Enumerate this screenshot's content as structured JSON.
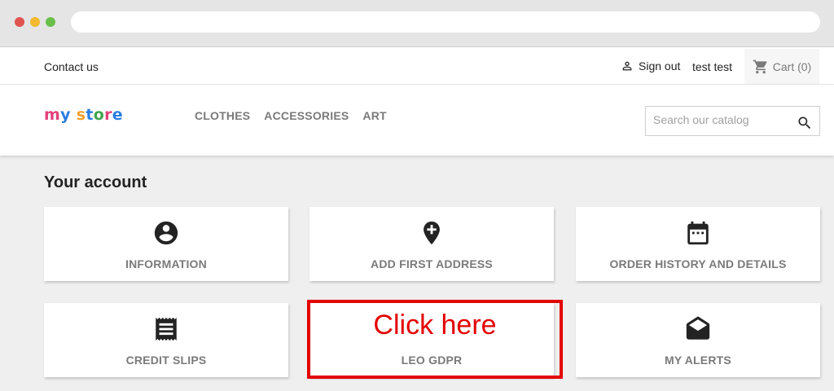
{
  "browser": {
    "dots": [
      "close",
      "minimize",
      "maximize"
    ]
  },
  "topnav": {
    "contact": "Contact us",
    "signout": "Sign out",
    "username": "test test",
    "cart": "Cart (0)"
  },
  "header": {
    "logo": "my store",
    "menu": [
      "CLOTHES",
      "ACCESSORIES",
      "ART"
    ],
    "search_placeholder": "Search our catalog"
  },
  "main": {
    "title": "Your account",
    "cards": [
      {
        "label": "INFORMATION",
        "icon": "account-circle-icon"
      },
      {
        "label": "ADD FIRST ADDRESS",
        "icon": "add-location-icon"
      },
      {
        "label": "ORDER HISTORY AND DETAILS",
        "icon": "calendar-icon"
      },
      {
        "label": "CREDIT SLIPS",
        "icon": "receipt-icon"
      },
      {
        "label": "LEO GDPR",
        "icon": ""
      },
      {
        "label": "MY ALERTS",
        "icon": "drafts-icon"
      }
    ],
    "annotation": "Click here"
  },
  "colors": {
    "annotation": "#e30000",
    "text_dark": "#232323",
    "text_muted": "#7a7a7a",
    "page_bg": "#efefef"
  }
}
